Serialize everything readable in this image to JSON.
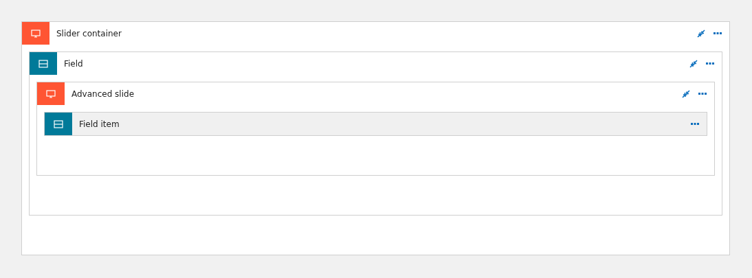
{
  "tree": [
    {
      "kind": "slide",
      "title": "Slider container",
      "collapsible": true,
      "children": [
        {
          "kind": "field",
          "title": "Field",
          "collapsible": true,
          "children": [
            {
              "kind": "slide",
              "title": "Advanced slide",
              "collapsible": true,
              "children": [
                {
                  "kind": "field",
                  "title": "Field item",
                  "collapsible": false
                }
              ]
            }
          ]
        }
      ]
    }
  ]
}
